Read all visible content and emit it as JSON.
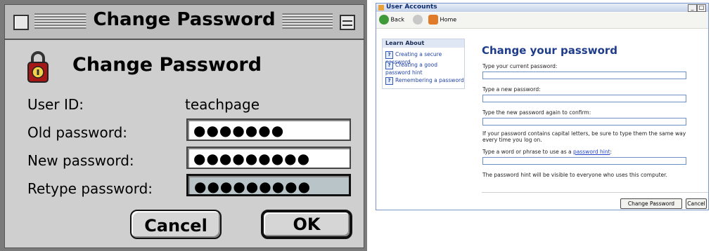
{
  "mac": {
    "window_title": "Change Password",
    "heading": "Change Password",
    "user_id_label": "User ID:",
    "user_id_value": "teachpage",
    "old_password_label": "Old password:",
    "old_password_value": "●●●●●●●",
    "new_password_label": "New password:",
    "new_password_value": "●●●●●●●●●",
    "retype_password_label": "Retype password:",
    "retype_password_value": "●●●●●●●●●",
    "cancel_label": "Cancel",
    "ok_label": "OK",
    "icon": "padlock-icon"
  },
  "xp": {
    "window_title": "User Accounts",
    "back_label": "Back",
    "home_label": "Home",
    "learn_about_heading": "Learn About",
    "links": [
      "Creating a secure password",
      "Creating a good password hint",
      "Remembering a password"
    ],
    "heading": "Change your password",
    "current_password_label": "Type your current password:",
    "new_password_label": "Type a new password:",
    "confirm_password_label": "Type the new password again to confirm:",
    "caps_note": "If your password contains capital letters, be sure to type them the same way every time you log on.",
    "hint_label_prefix": "Type a word or phrase to use as a ",
    "hint_link": "password hint",
    "hint_label_suffix": ":",
    "hint_note": "The password hint will be visible to everyone who uses this computer.",
    "change_button_label": "Change Password",
    "cancel_button_label": "Cancel"
  }
}
